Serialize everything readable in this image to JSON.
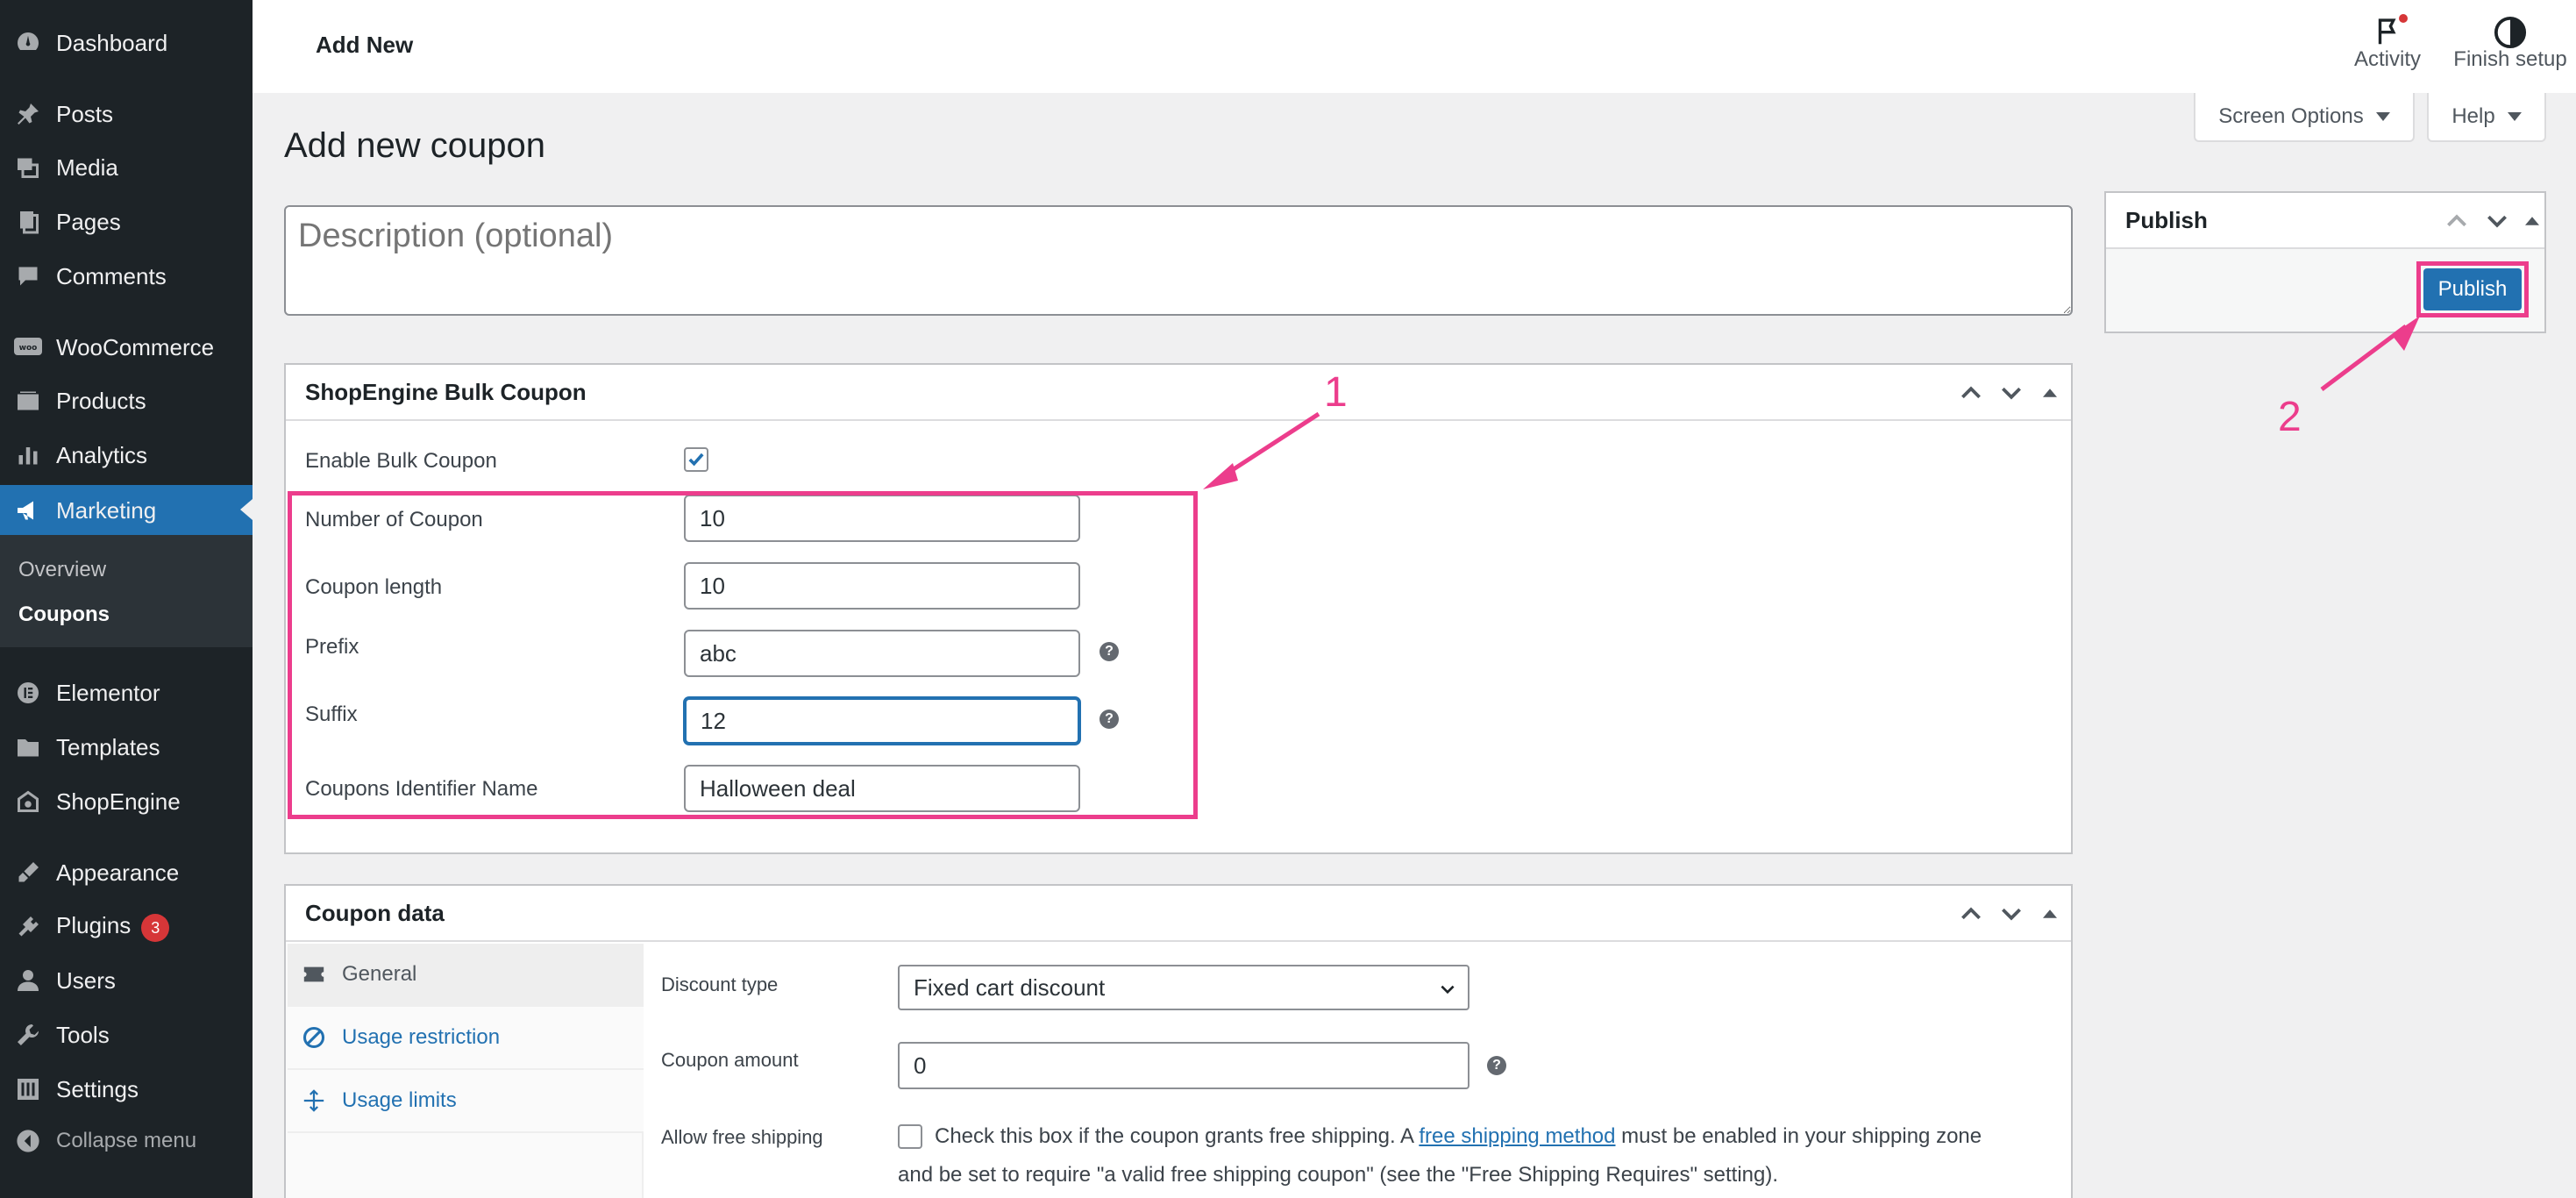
{
  "sidebar": {
    "items": [
      {
        "label": "Dashboard",
        "icon": "dashboard-icon"
      },
      {
        "label": "Posts",
        "icon": "pin-icon"
      },
      {
        "label": "Media",
        "icon": "media-icon"
      },
      {
        "label": "Pages",
        "icon": "pages-icon"
      },
      {
        "label": "Comments",
        "icon": "comments-icon"
      },
      {
        "label": "WooCommerce",
        "icon": "woocommerce-icon"
      },
      {
        "label": "Products",
        "icon": "products-icon"
      },
      {
        "label": "Analytics",
        "icon": "analytics-icon"
      },
      {
        "label": "Marketing",
        "icon": "megaphone-icon"
      },
      {
        "label": "Elementor",
        "icon": "elementor-icon"
      },
      {
        "label": "Templates",
        "icon": "folder-icon"
      },
      {
        "label": "ShopEngine",
        "icon": "shopengine-icon"
      },
      {
        "label": "Appearance",
        "icon": "brush-icon"
      },
      {
        "label": "Plugins",
        "icon": "plug-icon",
        "badge": "3"
      },
      {
        "label": "Users",
        "icon": "user-icon"
      },
      {
        "label": "Tools",
        "icon": "wrench-icon"
      },
      {
        "label": "Settings",
        "icon": "settings-icon"
      },
      {
        "label": "Collapse menu",
        "icon": "collapse-icon"
      }
    ],
    "submenu": [
      "Overview",
      "Coupons"
    ]
  },
  "topbar": {
    "title": "Add New",
    "activity": "Activity",
    "finish_setup": "Finish setup"
  },
  "screen_options": "Screen Options",
  "help": "Help",
  "page_title": "Add new coupon",
  "description_placeholder": "Description (optional)",
  "bulk_coupon": {
    "title": "ShopEngine Bulk Coupon",
    "enable_label": "Enable Bulk Coupon",
    "enabled": true,
    "fields": [
      {
        "label": "Number of Coupon",
        "value": "10"
      },
      {
        "label": "Coupon length",
        "value": "10"
      },
      {
        "label": "Prefix",
        "value": "abc"
      },
      {
        "label": "Suffix",
        "value": "12"
      },
      {
        "label": "Coupons Identifier Name",
        "value": "Halloween deal"
      }
    ]
  },
  "coupon_data": {
    "title": "Coupon data",
    "tabs": [
      "General",
      "Usage restriction",
      "Usage limits"
    ],
    "discount_type_label": "Discount type",
    "discount_type_value": "Fixed cart discount",
    "coupon_amount_label": "Coupon amount",
    "coupon_amount_value": "0",
    "free_shipping_label": "Allow free shipping",
    "free_shipping_text_1": "Check this box if the coupon grants free shipping. A",
    "free_shipping_link": "free shipping method",
    "free_shipping_text_2": "must be enabled in your shipping zone",
    "free_shipping_text_3": "and be set to require \"a valid free shipping coupon\" (see the \"Free Shipping Requires\" setting)."
  },
  "publish": {
    "title": "Publish",
    "button": "Publish"
  },
  "annotations": [
    "1",
    "2"
  ],
  "colors": {
    "sidebar_bg": "#1d2327",
    "active_blue": "#2271b1",
    "annotation_pink": "#ec3d8c"
  }
}
